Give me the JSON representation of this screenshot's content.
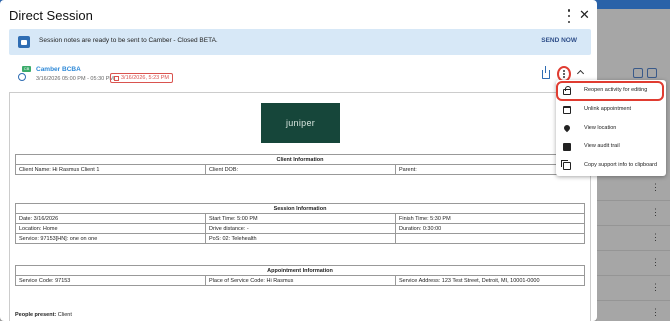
{
  "dialog": {
    "title": "Direct Session"
  },
  "banner": {
    "message": "Session notes are ready to be sent to Camber - Closed BETA.",
    "action_label": "SEND NOW"
  },
  "activity": {
    "badge": "CB",
    "name": "Camber BCBA",
    "datetime": "3/16/2026 05:00 PM - 05:30 PM",
    "tag": "3/16/2026, 5:23 PM"
  },
  "document": {
    "logo_text": "juniper",
    "client_info": {
      "header": "Client Information",
      "client_name": "Client Name: Hi Rasmus Client 1",
      "client_dob": "Client DOB:",
      "parent": "Parent:"
    },
    "session_info": {
      "header": "Session Information",
      "date": "Date: 3/16/2026",
      "start_time": "Start Time: 5:00 PM",
      "finish_time": "Finish Time: 5:30 PM",
      "location": "Location: Home",
      "drive_distance": "Drive distance: -",
      "duration": "Duration: 0:30:00",
      "service": "Service: 97153[HN]: one on one",
      "pos": "PoS: 02: Telehealth"
    },
    "appointment_info": {
      "header": "Appointment Information",
      "service_code": "Service Code: 97153",
      "place_of_service": "Place of Service Code: Hi Rasmus",
      "service_address": "Service Address: 123 Test Street, Detroit, MI, 10001-0000"
    },
    "people_present_label": "People present:",
    "people_present_value": "Client"
  },
  "menu": {
    "items": [
      {
        "label": "Reopen activity for editing",
        "icon": "lock-icon"
      },
      {
        "label": "Unlink appointment",
        "icon": "calendar-icon"
      },
      {
        "label": "View location",
        "icon": "location-pin-icon"
      },
      {
        "label": "View audit trail",
        "icon": "audit-trail-icon"
      },
      {
        "label": "Copy support info to clipboard",
        "icon": "copy-icon"
      }
    ]
  },
  "colors": {
    "accent": "#2f6db3",
    "banner_bg": "#d7e8f7",
    "highlight": "#e03c31",
    "logo_bg": "#16463a"
  }
}
